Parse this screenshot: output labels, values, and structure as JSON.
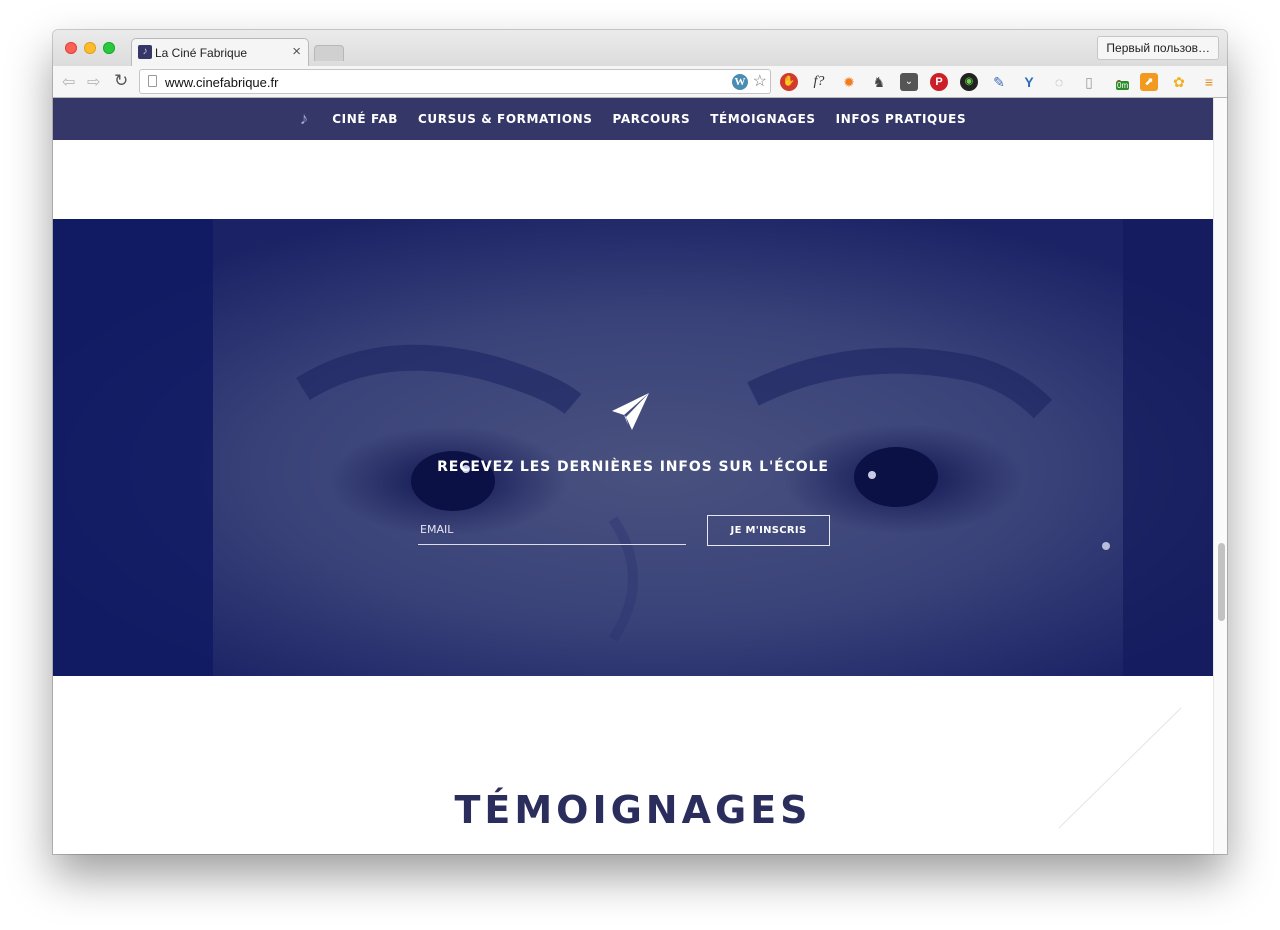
{
  "browser": {
    "tab_title": "La Ciné Fabrique",
    "tab_close": "×",
    "profile_label": "Первый пользов…",
    "url": "www.cinefabrique.fr",
    "extension_badge": "0m",
    "extensions": [
      "adblock-icon",
      "whatfont-icon",
      "hola-icon",
      "evernote-icon",
      "pocket-icon",
      "pinterest-icon",
      "screenshot-icon",
      "colorpicker-icon",
      "vimium-icon",
      "loading-icon",
      "reader-icon",
      "timer-icon",
      "analytics-icon",
      "pinwheel-icon",
      "menu-icon"
    ]
  },
  "site_nav": {
    "items": [
      {
        "label": "CINÉ FAB"
      },
      {
        "label": "CURSUS & FORMATIONS"
      },
      {
        "label": "PARCOURS"
      },
      {
        "label": "TÉMOIGNAGES"
      },
      {
        "label": "INFOS PRATIQUES"
      }
    ]
  },
  "newsletter": {
    "title": "RECEVEZ LES DERNIÈRES INFOS SUR L'ÉCOLE",
    "email_placeholder": "EMAIL",
    "button_label": "JE M'INSCRIS"
  },
  "testimonials": {
    "title": "TÉMOIGNAGES"
  },
  "colors": {
    "nav_bg": "#353768",
    "hero_tint": "#283074",
    "title_color": "#2b2d5c"
  }
}
